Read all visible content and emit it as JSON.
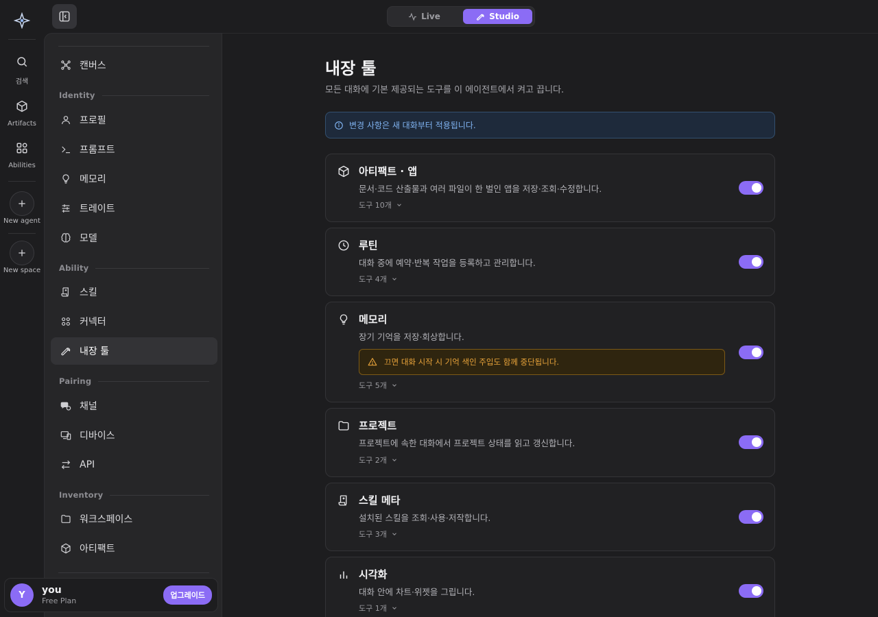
{
  "rail": {
    "items": [
      {
        "label": "검색",
        "icon": "search-icon"
      },
      {
        "label": "Artifacts",
        "icon": "cube-icon"
      },
      {
        "label": "Abilities",
        "icon": "grid-icon"
      }
    ],
    "new_agent": "New agent",
    "new_space": "New space"
  },
  "topbar": {
    "live_label": "Live",
    "studio_label": "Studio",
    "active": "Studio"
  },
  "sidebar": {
    "canvas": "캔버스",
    "sections": {
      "identity": "Identity",
      "ability": "Ability",
      "pairing": "Pairing",
      "inventory": "Inventory"
    },
    "identity_items": [
      "프로필",
      "프롬프트",
      "메모리",
      "트레이트",
      "모델"
    ],
    "ability_items": [
      "스킬",
      "커넥터",
      "내장 툴"
    ],
    "pairing_items": [
      "채널",
      "디바이스",
      "API"
    ],
    "inventory_items": [
      "워크스페이스",
      "아티팩트"
    ],
    "active_item": "내장 툴"
  },
  "user": {
    "initial": "Y",
    "name": "you",
    "plan": "Free Plan",
    "upgrade_label": "업그레이드"
  },
  "main": {
    "title": "내장 툴",
    "description": "모든 대화에 기본 제공되는 도구를 이 에이전트에서 켜고 끕니다.",
    "notice": "변경 사항은 새 대화부터 적용됩니다.",
    "cards": [
      {
        "title": "아티팩트 · 앱",
        "desc": "문서·코드 산출물과 여러 파일이 한 벌인 앱을 저장·조회·수정합니다.",
        "tools": "도구 10개",
        "enabled": true,
        "icon": "cube-icon"
      },
      {
        "title": "루틴",
        "desc": "대화 중에 예약·반복 작업을 등록하고 관리합니다.",
        "tools": "도구 4개",
        "enabled": true,
        "icon": "clock-icon"
      },
      {
        "title": "메모리",
        "desc": "장기 기억을 저장·회상합니다.",
        "tools": "도구 5개",
        "enabled": true,
        "icon": "lightbulb-icon",
        "warning": "끄면 대화 시작 시 기억 색인 주입도 함께 중단됩니다."
      },
      {
        "title": "프로젝트",
        "desc": "프로젝트에 속한 대화에서 프로젝트 상태를 읽고 갱신합니다.",
        "tools": "도구 2개",
        "enabled": true,
        "icon": "folder-icon"
      },
      {
        "title": "스킬 메타",
        "desc": "설치된 스킬을 조회·사용·저작합니다.",
        "tools": "도구 3개",
        "enabled": true,
        "icon": "scroll-icon"
      },
      {
        "title": "시각화",
        "desc": "대화 안에 차트·위젯을 그립니다.",
        "tools": "도구 1개",
        "enabled": true,
        "icon": "bar-chart-icon"
      }
    ]
  },
  "colors": {
    "accent": "#8b6cf5",
    "background": "#1d1d1f",
    "sidebar": "#262628",
    "notice_text": "#7fb2f0",
    "warning_text": "#e8a33a"
  }
}
